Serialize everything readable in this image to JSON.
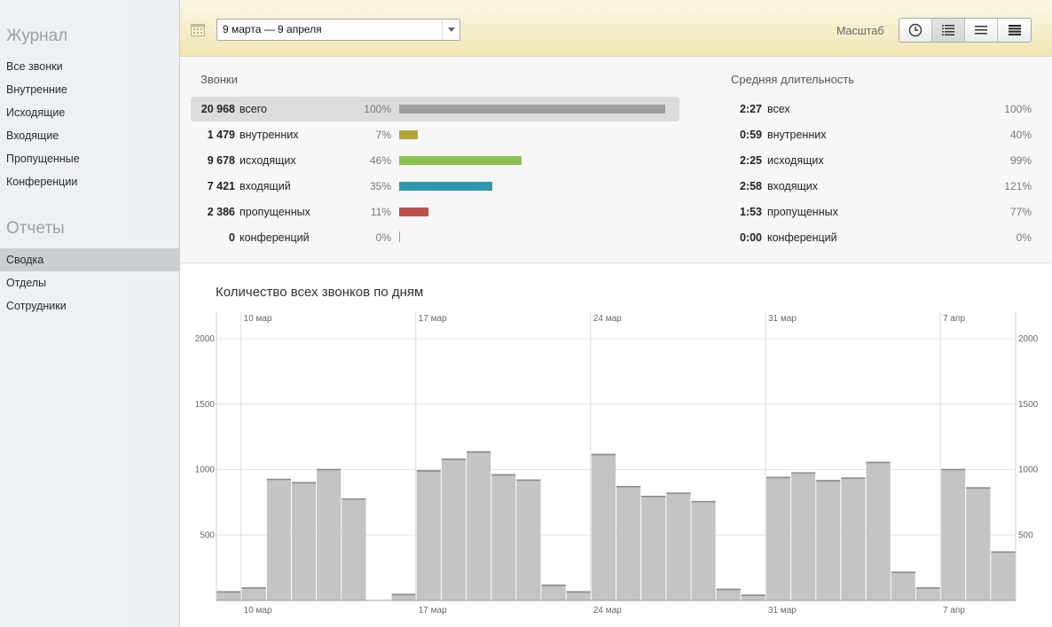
{
  "sidebar": {
    "journal_title": "Журнал",
    "journal_items": [
      "Все звонки",
      "Внутренние",
      "Исходящие",
      "Входящие",
      "Пропущенные",
      "Конференции"
    ],
    "reports_title": "Отчеты",
    "reports_items": [
      "Сводка",
      "Отделы",
      "Сотрудники"
    ],
    "active_report": "Сводка"
  },
  "toolbar": {
    "date_range": "9 марта — 9 апреля",
    "scale_label": "Масштаб",
    "scale_buttons": [
      "clock-icon",
      "list-detailed-icon",
      "list-medium-icon",
      "list-compact-icon"
    ],
    "active_scale": 1
  },
  "calls": {
    "title": "Звонки",
    "rows": [
      {
        "num": "20 968",
        "label": "всего",
        "pct": "100%",
        "value": 100,
        "color": "#a0a0a0"
      },
      {
        "num": "1 479",
        "label": "внутренних",
        "pct": "7%",
        "value": 7,
        "color": "#b5a33a"
      },
      {
        "num": "9 678",
        "label": "исходящих",
        "pct": "46%",
        "value": 46,
        "color": "#8cc150"
      },
      {
        "num": "7 421",
        "label": "входящий",
        "pct": "35%",
        "value": 35,
        "color": "#2f98ad"
      },
      {
        "num": "2 386",
        "label": "пропущенных",
        "pct": "11%",
        "value": 11,
        "color": "#c0504a"
      },
      {
        "num": "0",
        "label": "конференций",
        "pct": "0%",
        "value": 0,
        "color": "#999999"
      }
    ]
  },
  "duration": {
    "title": "Средняя длительность",
    "rows": [
      {
        "num": "2:27",
        "label": "всех",
        "pct": "100%"
      },
      {
        "num": "0:59",
        "label": "внутренних",
        "pct": "40%"
      },
      {
        "num": "2:25",
        "label": "исходящих",
        "pct": "99%"
      },
      {
        "num": "2:58",
        "label": "входящих",
        "pct": "121%"
      },
      {
        "num": "1:53",
        "label": "пропущенных",
        "pct": "77%"
      },
      {
        "num": "0:00",
        "label": "конференций",
        "pct": "0%"
      }
    ]
  },
  "chart_data": {
    "type": "bar",
    "title": "Количество всех звонков по дням",
    "x_ticks": [
      "10 мар",
      "17 мар",
      "24 мар",
      "31 мар",
      "7 апр"
    ],
    "x_tick_index": [
      1,
      8,
      15,
      22,
      29
    ],
    "y_ticks": [
      500,
      1000,
      1500,
      2000
    ],
    "ylim": [
      0,
      2000
    ],
    "bar_color": "#c4c4c4",
    "values": [
      70,
      100,
      930,
      905,
      1005,
      780,
      0,
      50,
      995,
      1085,
      1140,
      965,
      925,
      120,
      70,
      1120,
      875,
      800,
      825,
      760,
      90,
      45,
      945,
      980,
      920,
      940,
      1060,
      220,
      100,
      1005,
      865,
      375
    ]
  }
}
